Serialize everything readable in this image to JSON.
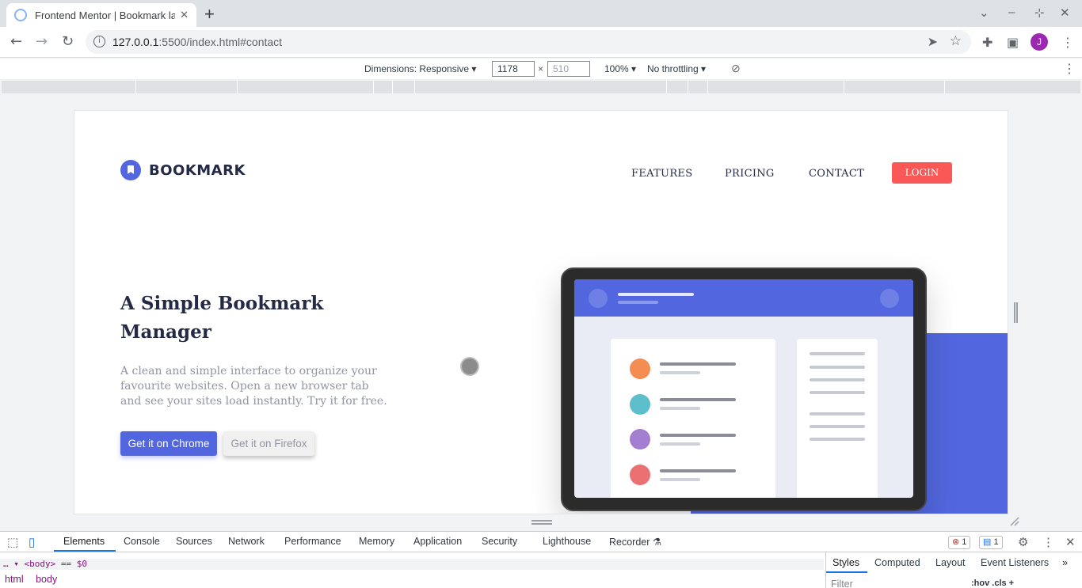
{
  "browser": {
    "tab_title": "Frontend Mentor | Bookmark la",
    "tab_close": "✕",
    "new_tab": "+",
    "url_host": "127.0.0.1",
    "url_path": ":5500/index.html#contact",
    "avatar_letter": "J",
    "icons": [
      "favicon-icon",
      "back-icon",
      "forward-icon",
      "reload-icon",
      "info-icon",
      "share-icon",
      "star-icon",
      "extensions-icon",
      "sidepanel-icon",
      "menu-icon"
    ]
  },
  "device_toolbar": {
    "dimensions_label": "Dimensions: Responsive ▾",
    "width": "1178",
    "height_placeholder": "510",
    "times": "×",
    "zoom": "100% ▾",
    "throttle": "No throttling ▾"
  },
  "page": {
    "brand": "BOOKMARK",
    "nav": [
      "FEATURES",
      "PRICING",
      "CONTACT"
    ],
    "login": "LOGIN",
    "hero_title": "A Simple Bookmark Manager",
    "hero_text": "A clean and simple interface to organize your favourite websites. Open a new browser tab and see your sites load instantly. Try it for free.",
    "cta_chrome": "Get it on Chrome",
    "cta_firefox": "Get it on Firefox",
    "colors": {
      "primary": "#5267df",
      "accent": "#fa5757",
      "dark": "#242a45",
      "muted": "#9194a2",
      "dot_orange": "#f38d52",
      "dot_teal": "#5ebfcc",
      "dot_purple": "#a37ed1",
      "dot_red": "#ec7072"
    }
  },
  "devtools": {
    "tabs": [
      "Elements",
      "Console",
      "Sources",
      "Network",
      "Performance",
      "Memory",
      "Application",
      "Security",
      "Lighthouse",
      "Recorder ⚗"
    ],
    "errors": "1",
    "messages": "1",
    "dom_line": "<body> == $0",
    "crumbs": [
      "html",
      "body"
    ],
    "side_tabs": [
      "Styles",
      "Computed",
      "Layout",
      "Event Listeners"
    ],
    "filter_placeholder": "Filter",
    "side_tools": ":hov  .cls  +"
  }
}
